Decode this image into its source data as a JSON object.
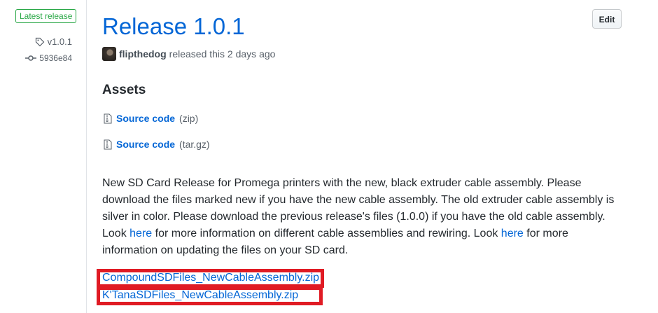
{
  "sidebar": {
    "latest_badge": "Latest release",
    "tag": "v1.0.1",
    "commit": "5936e84"
  },
  "release": {
    "title": "Release 1.0.1",
    "edit_label": "Edit",
    "author": "flipthedog",
    "released_text": "released this 2 days ago"
  },
  "assets": {
    "heading": "Assets",
    "items": [
      {
        "label": "Source code",
        "ext": "(zip)"
      },
      {
        "label": "Source code",
        "ext": "(tar.gz)"
      }
    ]
  },
  "body": {
    "p1": "New SD Card Release for Promega printers with the new, black extruder cable assembly. Please download the files marked new if you have the new cable assembly. The old extruder cable assembly is silver in color. Please download the previous release's files (1.0.0) if you have the old cable assembly. Look ",
    "link1": "here",
    "p2": " for more information on different cable assemblies and rewiring. Look ",
    "link2": "here",
    "p3": " for more information on updating the files on your SD card."
  },
  "files": [
    "CompoundSDFiles_NewCableAssembly.zip",
    "K'TanaSDFiles_NewCableAssembly.zip"
  ],
  "colors": {
    "link": "#0366d6",
    "badge_green": "#28a745",
    "highlight_red": "#e01b24"
  }
}
